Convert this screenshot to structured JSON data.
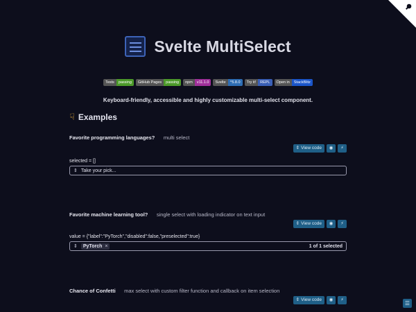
{
  "header": {
    "title": "Svelte MultiSelect",
    "tagline": "Keyboard-friendly, accessible and highly customizable multi-select component."
  },
  "badges": [
    {
      "left": "Tests",
      "right": "passing",
      "color": "#4c9a2a"
    },
    {
      "left": "GitHub Pages",
      "right": "passing",
      "color": "#4c9a2a"
    },
    {
      "left": "npm",
      "right": "v11.1.0",
      "color": "#a0309a"
    },
    {
      "left": "Svelte",
      "right": "^5.8.0",
      "color": "#2e6db4"
    },
    {
      "left": "Try it!",
      "right": "REPL",
      "color": "#3a5fb6"
    },
    {
      "left": "Open in",
      "right": "StackBlitz",
      "color": "#1b55c9"
    }
  ],
  "section": {
    "title": "Examples",
    "icon": "pointing-down-hand-icon"
  },
  "examples": [
    {
      "title": "Favorite programming languages?",
      "desc": "multi select",
      "view_code": "View code",
      "state": "selected = []",
      "placeholder": "Take your pick..."
    },
    {
      "title": "Favorite machine learning tool?",
      "desc": "single select with loading indicator on text input",
      "view_code": "View code",
      "state": "value = {\"label\":\"PyTorch\",\"disabled\":false,\"preselected\":true}",
      "chip": "PyTorch",
      "count": "1 of 1 selected"
    },
    {
      "title": "Chance of Confetti",
      "desc": "max select with custom filter function and callback on item selection",
      "view_code": "View code"
    }
  ],
  "colors": {
    "background": "#0d0e1c",
    "button": "#1f5f87",
    "accent": "#f2b33d"
  }
}
